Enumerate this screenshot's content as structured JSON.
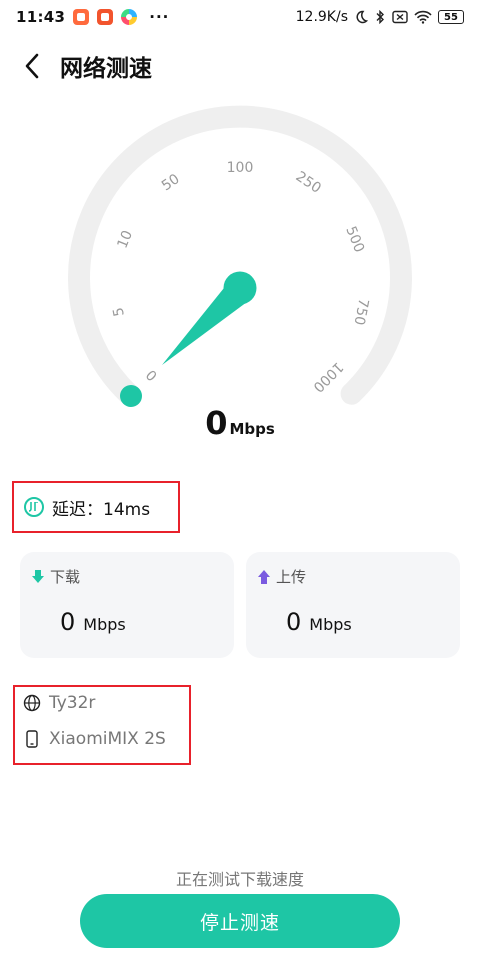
{
  "status_bar": {
    "time": "11:43",
    "dots": "···",
    "net_speed": "12.9K/s",
    "battery": "55",
    "icons": [
      "app-icon-1",
      "app-icon-2",
      "multicolor-app-icon",
      "moon-icon",
      "bluetooth-icon",
      "sim-off-icon",
      "wifi-icon",
      "battery-icon"
    ]
  },
  "header": {
    "back_icon": "chevron-left-icon",
    "title": "网络测速"
  },
  "gauge": {
    "tick_labels": [
      "0",
      "5",
      "10",
      "50",
      "100",
      "250",
      "500",
      "750",
      "1000"
    ],
    "needle_value": 0,
    "track_color": "#efefef",
    "accent_color": "#1ec6a5"
  },
  "speed": {
    "value": "0",
    "unit": "Mbps"
  },
  "latency": {
    "icon": "latency-icon",
    "text": "延迟：14ms"
  },
  "download": {
    "label": "下载",
    "value": "0",
    "unit": "Mbps",
    "color": "#1ec6a5"
  },
  "upload": {
    "label": "上传",
    "value": "0",
    "unit": "Mbps",
    "color": "#7a5ae0"
  },
  "device": {
    "network_name": "Ty32r",
    "device_name": "XiaomiMIX 2S"
  },
  "footer": {
    "status": "正在测试下载速度",
    "button_label": "停止测速"
  }
}
